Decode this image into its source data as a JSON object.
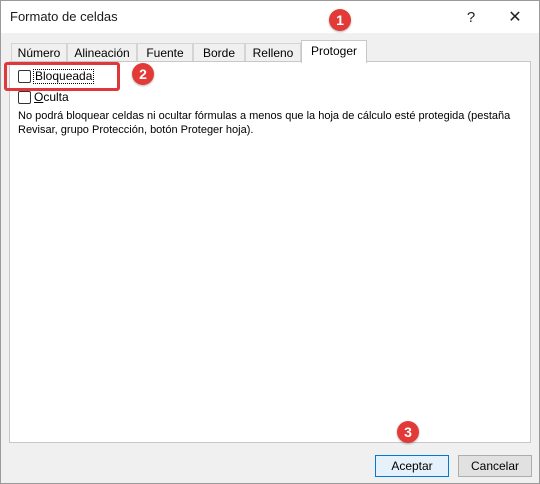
{
  "window": {
    "title": "Formato de celdas",
    "help_glyph": "?",
    "close_glyph": "✕"
  },
  "tabs": [
    {
      "label": "Número"
    },
    {
      "label": "Alineación"
    },
    {
      "label": "Fuente"
    },
    {
      "label": "Borde"
    },
    {
      "label": "Relleno"
    },
    {
      "label": "Protoger",
      "active": true
    }
  ],
  "protect": {
    "locked_label": "Bloqueada",
    "locked_checked": false,
    "hidden_label_accel": "O",
    "hidden_label_rest": "culta",
    "hidden_checked": false,
    "description": "No podrá bloquear celdas ni ocultar fórmulas a menos que la hoja de cálculo esté protegida (pestaña Revisar, grupo Protección, botón Proteger hoja)."
  },
  "buttons": {
    "ok": "Aceptar",
    "cancel": "Cancelar"
  },
  "annotations": {
    "one": "1",
    "two": "2",
    "three": "3",
    "color": "#e23a36"
  }
}
